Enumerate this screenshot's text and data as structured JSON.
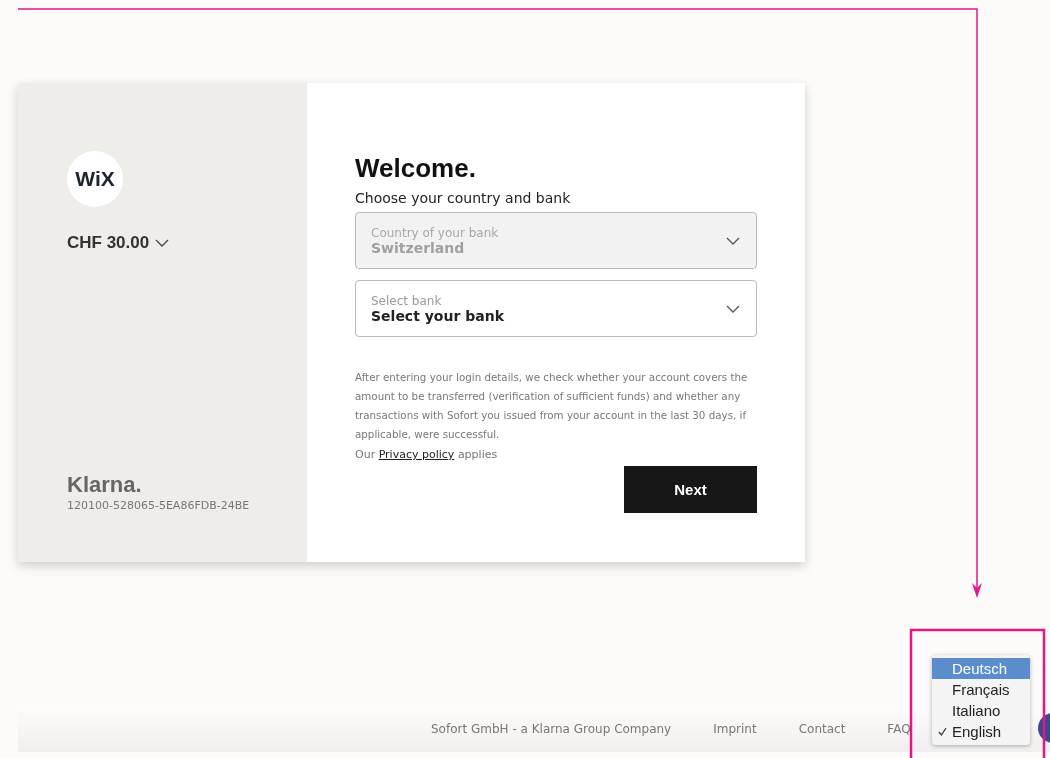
{
  "merchant": {
    "logo": "WiX",
    "amount": "CHF 30.00",
    "brand": "Klarna.",
    "reference": "120100-528065-5EA86FDB-24BE"
  },
  "form": {
    "title": "Welcome.",
    "subtitle": "Choose your country and bank",
    "fields": [
      {
        "label": "Country of your bank",
        "value": "Switzerland",
        "disabled": true
      },
      {
        "label": "Select bank",
        "value": "Select your bank",
        "disabled": false
      }
    ],
    "notice": "After entering your login details, we check whether your account covers the amount to be transferred (verification of sufficient funds) and whether any transactions with Sofort you issued from your account in the last 30 days, if applicable, were successful.",
    "privacy": {
      "before": "Our",
      "link": "Privacy policy",
      "after": "applies"
    },
    "button": "Next"
  },
  "footer": {
    "company": "Sofort GmbH - a Klarna Group Company",
    "links": [
      "Imprint",
      "Contact",
      "FAQ"
    ]
  },
  "language_menu": [
    {
      "label": "Deutsch",
      "highlighted": true,
      "checked": false
    },
    {
      "label": "Français",
      "highlighted": false,
      "checked": false
    },
    {
      "label": "Italiano",
      "highlighted": false,
      "checked": false
    },
    {
      "label": "English",
      "highlighted": false,
      "checked": true
    }
  ]
}
